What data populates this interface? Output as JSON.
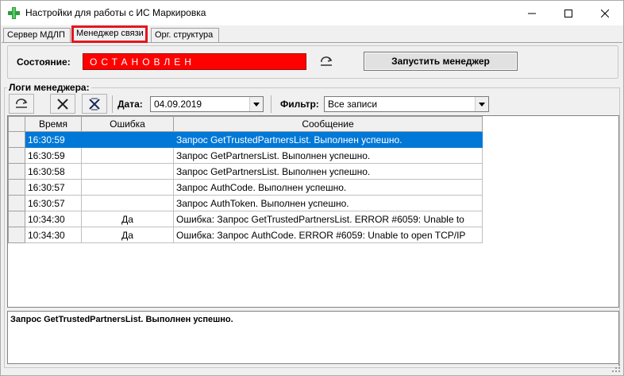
{
  "window": {
    "title": "Настройки для работы с ИС Маркировка",
    "icon": "green-cross-icon",
    "controls": [
      "minimize-icon",
      "maximize-icon",
      "close-icon"
    ]
  },
  "tabs": [
    {
      "label": "Сервер МДЛП",
      "active": false
    },
    {
      "label": "Менеджер связи",
      "active": true,
      "highlighted": true
    },
    {
      "label": "Орг. структура",
      "active": false
    }
  ],
  "state": {
    "label": "Состояние:",
    "value": "ОСТАНОВЛЕН",
    "value_color": "#fe0000",
    "start_button": "Запустить менеджер"
  },
  "logs": {
    "title": "Логи менеджера:",
    "toolbar": {
      "date_label": "Дата:",
      "date_value": "04.09.2019",
      "filter_label": "Фильтр:",
      "filter_value": "Все записи"
    },
    "columns": [
      "Время",
      "Ошибка",
      "Сообщение"
    ],
    "rows": [
      {
        "time": "16:30:59",
        "error": "",
        "message": "Запрос GetTrustedPartnersList. Выполнен успешно.",
        "selected": true
      },
      {
        "time": "16:30:59",
        "error": "",
        "message": "Запрос GetPartnersList. Выполнен успешно."
      },
      {
        "time": "16:30:58",
        "error": "",
        "message": "Запрос GetPartnersList. Выполнен успешно."
      },
      {
        "time": "16:30:57",
        "error": "",
        "message": "Запрос AuthCode. Выполнен успешно."
      },
      {
        "time": "16:30:57",
        "error": "",
        "message": "Запрос AuthToken. Выполнен успешно."
      },
      {
        "time": "10:34:30",
        "error": "Да",
        "message": "Ошибка: Запрос GetTrustedPartnersList. ERROR #6059: Unable to"
      },
      {
        "time": "10:34:30",
        "error": "Да",
        "message": "Ошибка: Запрос AuthCode. ERROR #6059: Unable to open TCP/IP"
      }
    ],
    "detail": "Запрос GetTrustedPartnersList. Выполнен успешно."
  },
  "colors": {
    "selection": "#0078d7",
    "tab_highlight": "#e3161f",
    "icon_green": "#2e9e3a"
  }
}
